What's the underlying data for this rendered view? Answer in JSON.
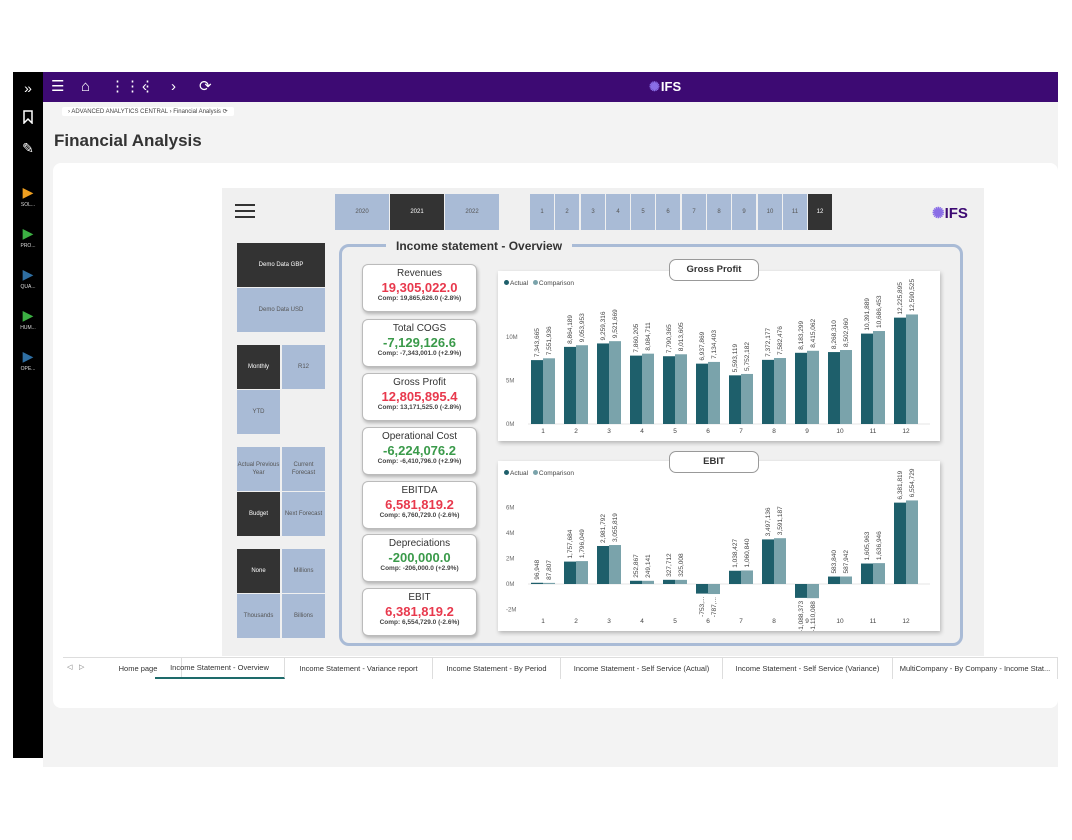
{
  "rail": {
    "items": [
      {
        "icon": "expand-icon",
        "glyph": "»",
        "label": ""
      },
      {
        "icon": "bookmark-icon",
        "glyph": "🔖",
        "label": ""
      },
      {
        "icon": "pencil-icon",
        "glyph": "✎",
        "label": ""
      },
      {
        "icon": "play-icon",
        "glyph": "▶",
        "label": "SOL...",
        "color": "#f0a020"
      },
      {
        "icon": "play-icon",
        "glyph": "▶",
        "label": "PRO...",
        "color": "#3cb043"
      },
      {
        "icon": "play-icon",
        "glyph": "▶",
        "label": "QUA...",
        "color": "#2f6fa3"
      },
      {
        "icon": "play-icon",
        "glyph": "▶",
        "label": "HUM...",
        "color": "#3cb043"
      },
      {
        "icon": "play-icon",
        "glyph": "▶",
        "label": "OPE...",
        "color": "#2f6fa3"
      }
    ]
  },
  "topbar": {
    "logo": "IFS",
    "brand_color": "#3d0a73"
  },
  "breadcrumb": {
    "text": "› ADVANCED ANALYTICS CENTRAL › Financial Analysis ⟳"
  },
  "page": {
    "title": "Financial Analysis"
  },
  "report": {
    "title": "Income statement - Overview",
    "logo": "IFS",
    "years": [
      "2020",
      "2021",
      "2022"
    ],
    "selected_year": "2021",
    "months": [
      "1",
      "2",
      "3",
      "4",
      "5",
      "6",
      "7",
      "8",
      "9",
      "10",
      "11",
      "12"
    ],
    "selected_month": "12",
    "slicers": {
      "company": {
        "options": [
          "Demo Data GBP",
          "Demo Data USD"
        ],
        "selected": "Demo Data GBP"
      },
      "period": {
        "options": [
          "Monthly",
          "R12",
          "YTD"
        ],
        "selected": "Monthly"
      },
      "comparison": {
        "options": [
          "Actual Previous Year",
          "Current Forecast",
          "Budget",
          "Next Forecast"
        ],
        "selected": "Budget"
      },
      "units": {
        "options": [
          "None",
          "Millions",
          "Thousands",
          "Billions"
        ],
        "selected": "None"
      }
    },
    "kpis": [
      {
        "label": "Revenues",
        "value": "19,305,022.0",
        "comp": "Comp: 19,865,626.0 (-2.8%)",
        "status": "red"
      },
      {
        "label": "Total COGS",
        "value": "-7,129,126.6",
        "comp": "Comp: -7,343,001.0 (+2.9%)",
        "status": "green"
      },
      {
        "label": "Gross Profit",
        "value": "12,805,895.4",
        "comp": "Comp: 13,171,525.0 (-2.8%)",
        "status": "red"
      },
      {
        "label": "Operational Cost",
        "value": "-6,224,076.2",
        "comp": "Comp: -6,410,796.0 (+2.9%)",
        "status": "green"
      },
      {
        "label": "EBITDA",
        "value": "6,581,819.2",
        "comp": "Comp: 6,760,729.0 (-2.6%)",
        "status": "red"
      },
      {
        "label": "Depreciations",
        "value": "-200,000.0",
        "comp": "Comp: -206,000.0 (+2.9%)",
        "status": "green"
      },
      {
        "label": "EBIT",
        "value": "6,381,819.2",
        "comp": "Comp: 6,554,729.0 (-2.6%)",
        "status": "red"
      }
    ],
    "colors": {
      "actual": "#1e5f6b",
      "comparison": "#7aa3ab",
      "red": "#e8394d",
      "green": "#3a9a4a"
    }
  },
  "chart_data": [
    {
      "type": "bar",
      "title": "Gross Profit",
      "legend": [
        "Actual",
        "Comparison"
      ],
      "legend_position": "top-left",
      "categories": [
        "1",
        "2",
        "3",
        "4",
        "5",
        "6",
        "7",
        "8",
        "9",
        "10",
        "11",
        "12"
      ],
      "series": [
        {
          "name": "Actual",
          "values": [
            7343665,
            8864189,
            9259316,
            7860205,
            7790365,
            6937869,
            5593119,
            7372177,
            8183299,
            8268310,
            10391889,
            12225895
          ]
        },
        {
          "name": "Comparison",
          "values": [
            7551936,
            9053953,
            9521669,
            8084711,
            8013605,
            7134403,
            5752182,
            7582476,
            8415062,
            8502960,
            10686453,
            12590525
          ]
        }
      ],
      "labels_actual": [
        "7,343,665",
        "8,864,189",
        "9,259,316",
        "7,860,205",
        "7,790,365",
        "6,937,869",
        "5,593,119",
        "7,372,177",
        "8,183,299",
        "8,268,310",
        "10,391,889",
        "12,225,895"
      ],
      "labels_comparison": [
        "7,551,936",
        "9,053,953",
        "9,521,669",
        "8,084,711",
        "8,013,605",
        "7,134,403",
        "5,752,182",
        "7,582,476",
        "8,415,062",
        "8,502,960",
        "10,686,453",
        "12,590,525"
      ],
      "yticks": [
        "0M",
        "5M",
        "10M"
      ],
      "ylim": [
        0,
        14000000
      ]
    },
    {
      "type": "bar",
      "title": "EBIT",
      "legend": [
        "Actual",
        "Comparison"
      ],
      "legend_position": "top-left",
      "categories": [
        "1",
        "2",
        "3",
        "4",
        "5",
        "6",
        "7",
        "8",
        "9",
        "10",
        "11",
        "12"
      ],
      "series": [
        {
          "name": "Actual",
          "values": [
            96948,
            1757684,
            2981792,
            252867,
            327712,
            -753000,
            1038427,
            3497136,
            -1088373,
            583840,
            1605963,
            6381819
          ]
        },
        {
          "name": "Comparison",
          "values": [
            87807,
            1796049,
            3055819,
            249141,
            325008,
            -787000,
            1060840,
            3591187,
            -1110088,
            587942,
            1636946,
            6554729
          ]
        }
      ],
      "labels_actual": [
        "96,948",
        "1,757,684",
        "2,981,792",
        "252,867",
        "327,712",
        "-753,...",
        "1,038,427",
        "3,497,136",
        "-1,088,373",
        "583,840",
        "1,605,963",
        "6,381,819"
      ],
      "labels_comparison": [
        "87,807",
        "1,796,049",
        "3,055,819",
        "249,141",
        "325,008",
        "-787,...",
        "1,060,840",
        "3,591,187",
        "-1,110,088",
        "587,942",
        "1,636,946",
        "6,554,729"
      ],
      "yticks": [
        "-2M",
        "0M",
        "2M",
        "4M",
        "6M"
      ],
      "ylim": [
        -2000000,
        7000000
      ]
    }
  ],
  "tabs": {
    "items": [
      "Home page",
      "Income Statement - Overview",
      "Income Statement - Variance report",
      "Income Statement - By Period",
      "Income Statement - Self Service (Actual)",
      "Income Statement - Self Service (Variance)",
      "MultiCompany - By Company - Income Stat..."
    ],
    "active": "Income Statement - Overview"
  }
}
